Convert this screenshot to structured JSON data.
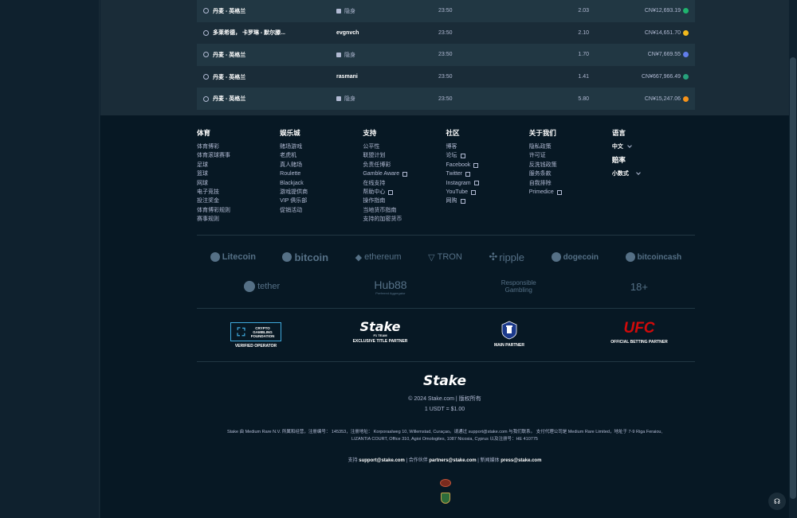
{
  "bets": [
    {
      "game": "丹麦 - 英格兰",
      "user": "隐身",
      "hidden": true,
      "time": "23:50",
      "odds": "2.03",
      "payout": "CN¥12,693.19",
      "coin": "#1fb46e"
    },
    {
      "game": "多莱希德， 卡罗琳 - 默尔滕...",
      "user": "evgnvch",
      "hidden": false,
      "time": "23:50",
      "odds": "2.10",
      "payout": "CN¥14,651.70",
      "coin": "#f2b91c"
    },
    {
      "game": "丹麦 - 英格兰",
      "user": "隐身",
      "hidden": true,
      "time": "23:50",
      "odds": "1.70",
      "payout": "CN¥7,669.55",
      "coin": "#627eea"
    },
    {
      "game": "丹麦 - 英格兰",
      "user": "rasmani",
      "hidden": false,
      "time": "23:50",
      "odds": "1.41",
      "payout": "CN¥667,966.49",
      "coin": "#26a17b"
    },
    {
      "game": "丹麦 - 英格兰",
      "user": "隐身",
      "hidden": true,
      "time": "23:50",
      "odds": "5.80",
      "payout": "CN¥15,247.06",
      "coin": "#f7931a"
    }
  ],
  "footer": {
    "sports": {
      "title": "体育",
      "links": [
        "体育博彩",
        "体育滚球赛事",
        "足球",
        "篮球",
        "网球",
        "电子竞技",
        "投注奖金",
        "体育博彩规则",
        "赛事规则"
      ]
    },
    "casino": {
      "title": "娱乐城",
      "links": [
        "赌场游戏",
        "老虎机",
        "真人赌场",
        "Roulette",
        "Blackjack",
        "游戏提供商",
        "VIP 俱乐部",
        "促销活动"
      ]
    },
    "support": {
      "title": "支持",
      "links": [
        "公平性",
        "联盟计划",
        "负责任博彩",
        "Gamble Aware",
        "在线支持",
        "帮助中心",
        "操作指南",
        "当地货币指南",
        "支持的加密货币"
      ]
    },
    "community": {
      "title": "社区",
      "links": [
        "博客",
        "论坛",
        "Facebook",
        "Twitter",
        "Instagram",
        "YouTube",
        "网购"
      ]
    },
    "about": {
      "title": "关于我们",
      "links": [
        "隐私政策",
        "许可证",
        "反洗钱政策",
        "服务条款",
        "自我排除",
        "Primedice"
      ]
    },
    "language": {
      "title": "语言",
      "value": "中文",
      "odds_title": "赔率",
      "odds_value": "小数式"
    }
  },
  "crypto_logos": [
    "Litecoin",
    "bitcoin",
    "ethereum",
    "TRON",
    "ripple",
    "dogecoin",
    "bitcoincash"
  ],
  "logos_row2": [
    "tether",
    "Hub88",
    "Preferred Aggregator",
    "Responsible",
    "Gambling",
    "18+"
  ],
  "partners": {
    "cgf_line1": "CRYPTO",
    "cgf_line2": "GAMBLING",
    "cgf_line3": "FOUNDATION",
    "cgf_caption": "VERIFIED OPERATOR",
    "stake_f1": "Stake",
    "stake_f1_sub": "F1 TEAM",
    "stake_f1_caption": "EXCLUSIVE TITLE PARTNER",
    "everton_caption": "MAIN PARTNER",
    "ufc": "UFC",
    "ufc_caption": "OFFICIAL BETTING PARTNER"
  },
  "bottom": {
    "logo": "Stake",
    "copyright": "© 2024 Stake.com | 版权所有",
    "rate": "1 USDT = $1.00",
    "legal_1": "Stake 由 Medium Rare N.V. 所属和经营，注册编号： 145353，注册地址： Korporaalweg 10, Willemstad, Curaçao。请通过 support@stake.com 与我们联系。 支付代理公司是 Medium Rare Limited，地址于 7-9 Riga Feraiou,",
    "legal_2": "LIZANTIA COURT, Office 310, Agioi Omologites, 1087 Nicosia, Cyprus 以及注册号：HE 410775",
    "support_label": "支持",
    "support_email": "support@stake.com",
    "partners_label": "合作伙伴",
    "partners_email": "partners@stake.com",
    "press_label": "新闻媒体",
    "press_email": "press@stake.com"
  },
  "colors": {
    "accent": "#1475e1",
    "ufc_red": "#d20a0a",
    "cgf_blue": "#3fa9dc"
  }
}
